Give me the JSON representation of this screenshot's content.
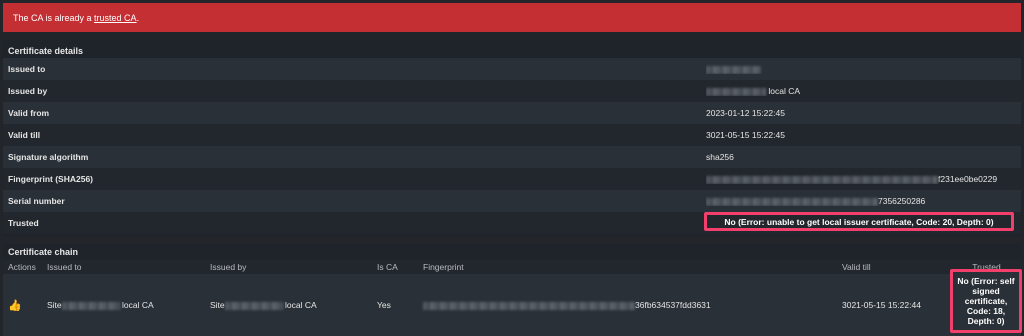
{
  "alert": {
    "prefix": "The CA is already a ",
    "link": "trusted CA",
    "suffix": ".",
    "color": "#c42f33"
  },
  "details": {
    "title": "Certificate details",
    "rows": [
      {
        "label": "Issued to",
        "value": ""
      },
      {
        "label": "Issued by",
        "value": "local CA"
      },
      {
        "label": "Valid from",
        "value": "2023-01-12 15:22:45"
      },
      {
        "label": "Valid till",
        "value": "3021-05-15 15:22:45"
      },
      {
        "label": "Signature algorithm",
        "value": "sha256"
      },
      {
        "label": "Fingerprint (SHA256)",
        "value": "f231ee0be0229"
      },
      {
        "label": "Serial number",
        "value": "7356250286"
      },
      {
        "label": "Trusted",
        "value": "No (Error: unable to get local issuer certificate, Code: 20, Depth: 0)"
      }
    ]
  },
  "chain": {
    "title": "Certificate chain",
    "headers": {
      "actions": "Actions",
      "issued_to": "Issued to",
      "issued_by": "Issued by",
      "is_ca": "Is CA",
      "fingerprint": "Fingerprint",
      "valid_till": "Valid till",
      "trusted": "Trusted"
    },
    "rows": [
      {
        "action_icon": "thumbs-up-icon",
        "issued_to_prefix": "Site",
        "issued_to_suffix": "local CA",
        "issued_by_prefix": "Site",
        "issued_by_suffix": "local CA",
        "is_ca": "Yes",
        "fingerprint": "36fb634537fdd3631",
        "valid_till": "3021-05-15 15:22:44",
        "trusted": "No (Error: self signed certificate, Code: 18, Depth: 0)"
      }
    ]
  },
  "highlight_color": "#f23f6c"
}
